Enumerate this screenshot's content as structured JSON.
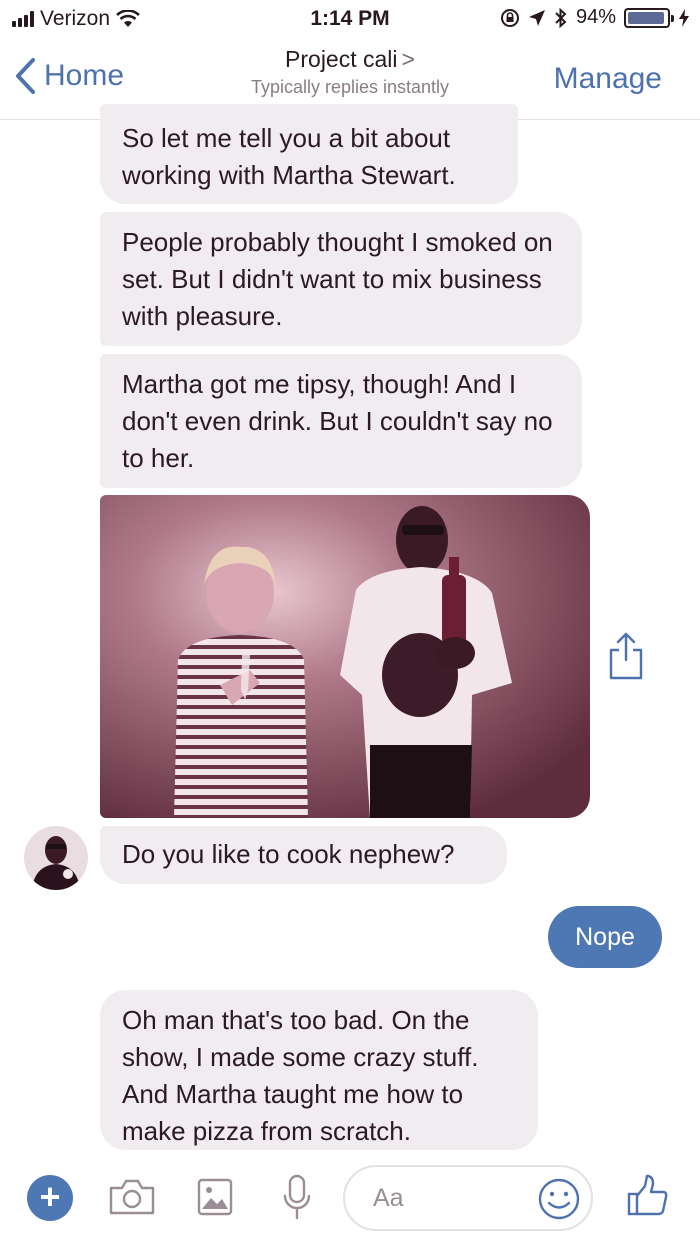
{
  "status_bar": {
    "carrier": "Verizon",
    "time": "1:14 PM",
    "battery_percent": "94%",
    "battery_level": 0.94
  },
  "nav": {
    "back_label": "Home",
    "title": "Project cali",
    "title_chevron": ">",
    "subtitle": "Typically replies instantly",
    "manage_label": "Manage"
  },
  "messages": {
    "m1": "So let me tell you a bit about working with Martha Stewart.",
    "m2": "People probably thought I smoked on set. But I didn't want to mix business with pleasure.",
    "m3": "Martha got me tipsy, though! And I don't even drink. But I couldn't say no to her.",
    "m4": "Do you like to cook nephew?",
    "my_reply": "Nope",
    "m5": "Oh man that's too bad. On the show, I made some crazy stuff. And Martha taught me how to make pizza from scratch."
  },
  "composer": {
    "placeholder": "Aa"
  },
  "icons": {
    "plus": "plus-icon",
    "camera": "camera-icon",
    "gallery": "image-icon",
    "mic": "microphone-icon",
    "emoji": "emoji-icon",
    "like": "thumbs-up-icon",
    "share": "share-icon"
  },
  "colors": {
    "accent": "#4e78b3",
    "incoming_bubble": "#f0ecef",
    "photo_tint": "#7a3a4e"
  }
}
